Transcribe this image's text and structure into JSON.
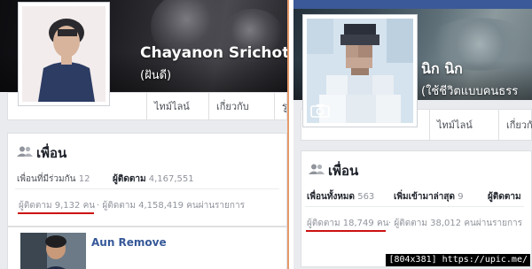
{
  "left_profile": {
    "name": "Chayanon Srichot",
    "nickname": "(ฝันดี)",
    "tabs": [
      "ไทม์ไลน์",
      "เกี่ยวกับ",
      "รูป"
    ],
    "friends_card": {
      "title": "เพื่อน",
      "filters": [
        {
          "label": "เพื่อนที่มีร่วมกัน",
          "count": "12"
        },
        {
          "label": "ผู้ติดตาม",
          "count": "4,167,551"
        }
      ],
      "followers_row": {
        "label": "ผู้ติดตาม",
        "count": "9,132",
        "unit": "คน"
      },
      "subscribers_row": {
        "label": "ผู้ติดตาม",
        "count": "4,158,419",
        "text": "คนผ่านรายการ"
      },
      "friend_preview_name": "Aun Remove"
    }
  },
  "right_profile": {
    "name": "นิก นิก",
    "nickname": "(ใช้ชีวิตแบบคนธรร",
    "tabs": [
      "ไทม์ไลน์",
      "เกี่ยวกับ"
    ],
    "friends_card": {
      "title": "เพื่อน",
      "filters": [
        {
          "label": "เพื่อนทั้งหมด",
          "count": "563"
        },
        {
          "label": "เพิ่มเข้ามาล่าสุด",
          "count": "9"
        },
        {
          "label": "ผู้ติดตาม",
          "count": ""
        }
      ],
      "followers_row": {
        "label": "ผู้ติดตาม",
        "count": "18,749",
        "unit": "คน"
      },
      "subscribers_row": {
        "label": "ผู้ติดตาม",
        "count": "38,012",
        "text": "คนผ่านรายการ"
      }
    }
  },
  "watermark": "[804x381] https://upic.me/",
  "colors": {
    "accent_underline": "#cc1111",
    "link": "#365899",
    "divider": "#e69a6b",
    "fb_blue": "#3b5998"
  }
}
